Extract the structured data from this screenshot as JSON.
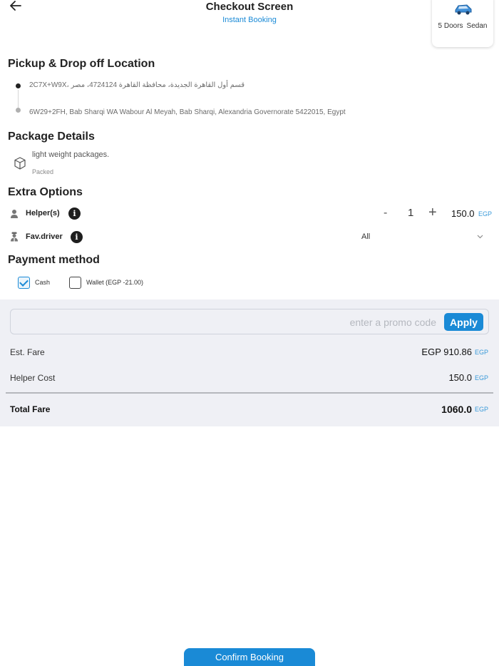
{
  "header": {
    "title": "Checkout Screen",
    "subtitle": "Instant Booking",
    "back_icon": "arrow-left-icon",
    "vehicle": {
      "icon": "car-icon",
      "doors": "5 Doors",
      "type": "Sedan"
    }
  },
  "locations": {
    "title": "Pickup & Drop off Location",
    "pickup": "2C7X+W9X، قسم أول القاهرة الجديدة، محافظة القاهرة 4724124، مصر",
    "dropoff": "6W29+2FH, Bab Sharqi WA Wabour Al Meyah, Bab Sharqi, Alexandria Governorate 5422015, Egypt"
  },
  "package": {
    "title": "Package Details",
    "icon": "package-box-icon",
    "name": "light weight packages.",
    "type": "Packed"
  },
  "extra_options": {
    "title": "Extra Options",
    "helper": {
      "icon": "person-icon",
      "label": "Helper(s)",
      "info_icon": "info-icon",
      "minus": "-",
      "count": "1",
      "plus": "+",
      "price": "150.0",
      "currency": "EGP"
    },
    "driver": {
      "icon": "driver-icon",
      "label": "Fav.driver",
      "info_icon": "info-icon",
      "selected": "All",
      "chevron": "chevron-down-icon"
    }
  },
  "payment": {
    "title": "Payment method",
    "options": [
      {
        "label": "Cash",
        "checked": true
      },
      {
        "label": "Wallet (EGP -21.00)",
        "checked": false
      }
    ]
  },
  "promo": {
    "placeholder": "enter a promo code",
    "apply_label": "Apply"
  },
  "fares": {
    "est_fare_label": "Est. Fare",
    "est_fare_value": "EGP 910.86",
    "helper_cost_label": "Helper Cost",
    "helper_cost_value": "150.0",
    "total_label": "Total Fare",
    "total_value": "1060.0",
    "currency": "EGP"
  },
  "confirm_label": "Confirm Booking",
  "colors": {
    "accent": "#1a8ad6",
    "summary_bg": "#eff0f5"
  }
}
